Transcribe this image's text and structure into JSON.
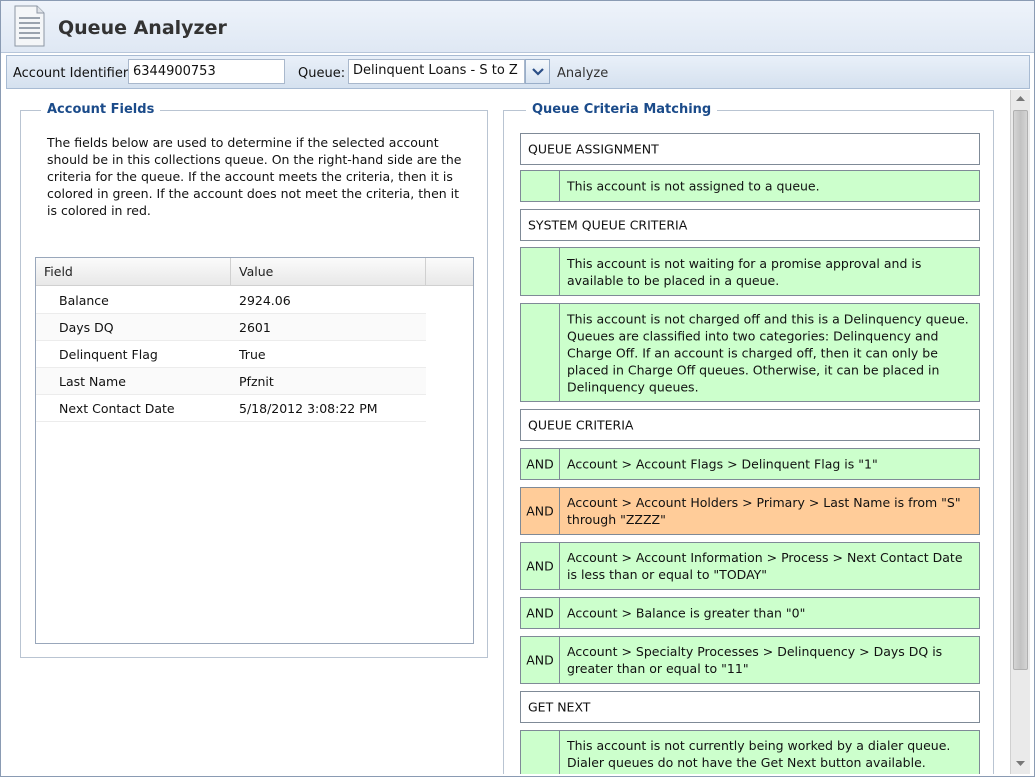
{
  "app": {
    "title": "Queue Analyzer"
  },
  "toolbar": {
    "account_label": "Account Identifier:",
    "account_value": "6344900753",
    "queue_label": "Queue:",
    "queue_value": "Delinquent Loans - S to Z",
    "analyze_label": "Analyze"
  },
  "account_fields": {
    "legend": "Account Fields",
    "description": "The fields below are used to determine if the selected account should be in this collections queue. On the right-hand side are the criteria for the queue. If the account meets the criteria, then it is colored in green. If the account does not meet the criteria, then it is colored in red.",
    "columns": [
      "Field",
      "Value"
    ],
    "rows": [
      {
        "field": "Balance",
        "value": "2924.06"
      },
      {
        "field": "Days DQ",
        "value": "2601"
      },
      {
        "field": "Delinquent Flag",
        "value": "True"
      },
      {
        "field": "Last Name",
        "value": "Pfznit"
      },
      {
        "field": "Next Contact Date",
        "value": "5/18/2012 3:08:22 PM"
      }
    ]
  },
  "criteria": {
    "legend": "Queue Criteria Matching",
    "items": [
      {
        "kind": "header",
        "text": "QUEUE ASSIGNMENT"
      },
      {
        "kind": "green",
        "lead": "",
        "text": "This account is not assigned to a queue."
      },
      {
        "kind": "header",
        "text": "SYSTEM QUEUE CRITERIA"
      },
      {
        "kind": "green",
        "lead": "",
        "text": "This account is not waiting for a promise approval and is available to be placed in a queue."
      },
      {
        "kind": "green",
        "lead": "",
        "text": "This account is not charged off and this is a Delinquency queue. Queues are classified into two categories: Delinquency and Charge Off. If an account is charged off, then it can only be placed in Charge Off queues. Otherwise, it can be placed in Delinquency queues."
      },
      {
        "kind": "header",
        "text": "QUEUE CRITERIA"
      },
      {
        "kind": "green",
        "lead": "AND",
        "text": "Account > Account Flags > Delinquent Flag is \"1\""
      },
      {
        "kind": "orange",
        "lead": "AND",
        "text": "Account > Account Holders > Primary > Last Name is from \"S\" through \"ZZZZ\""
      },
      {
        "kind": "green",
        "lead": "AND",
        "text": "Account > Account Information > Process > Next Contact Date is less than or equal to \"TODAY\""
      },
      {
        "kind": "green",
        "lead": "AND",
        "text": "Account > Balance is greater than \"0\""
      },
      {
        "kind": "green",
        "lead": "AND",
        "text": "Account > Specialty Processes > Delinquency > Days DQ is greater than or equal to \"11\""
      },
      {
        "kind": "header",
        "text": "GET NEXT"
      },
      {
        "kind": "green",
        "lead": "",
        "text": "This account is not currently being worked by a dialer queue. Dialer queues do not have the Get Next button available."
      }
    ]
  },
  "colors": {
    "match": "#ccffcc",
    "mismatch": "#ffcc99",
    "legend": "#1b4b8a"
  }
}
